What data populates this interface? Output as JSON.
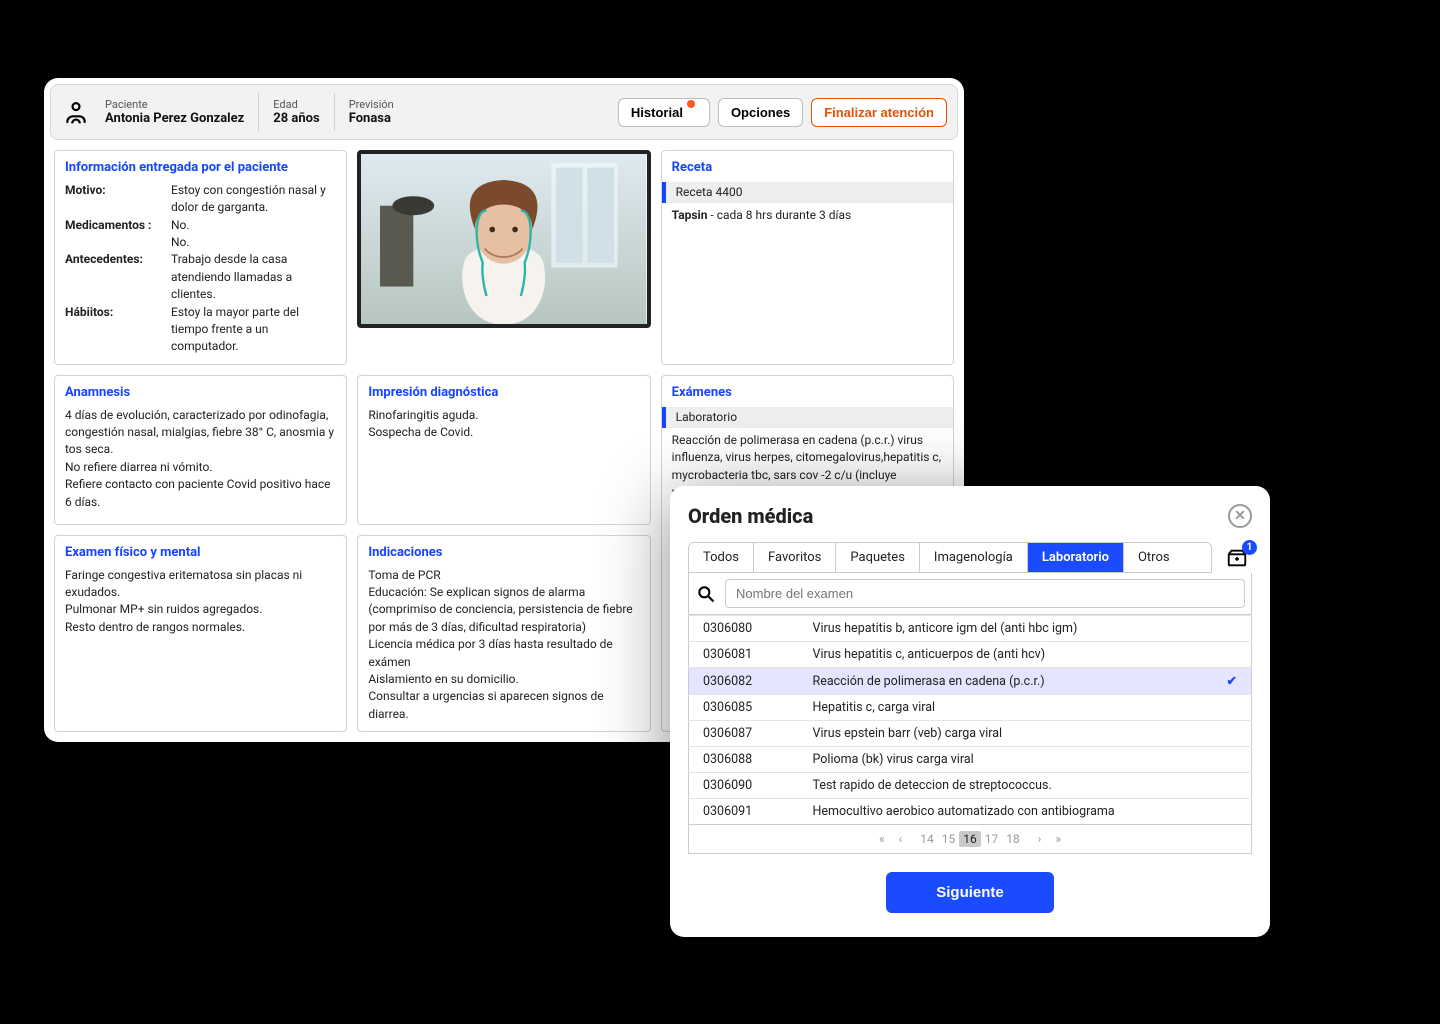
{
  "header": {
    "paciente_label": "Paciente",
    "paciente_value": "Antonia Perez Gonzalez",
    "edad_label": "Edad",
    "edad_value": "28 años",
    "prevision_label": "Previsión",
    "prevision_value": "Fonasa",
    "historial_btn": "Historial",
    "opciones_btn": "Opciones",
    "finalizar_btn": "Finalizar atención"
  },
  "info_card": {
    "title": "Información entregada por el paciente",
    "motivo_k": "Motivo:",
    "motivo_v": "Estoy con congestión nasal y dolor de garganta.",
    "medicamentos_k": "Medicamentos :",
    "medicamentos_v1": "No.",
    "medicamentos_v2": "No.",
    "antecedentes_k": "Antecedentes:",
    "antecedentes_v": "Trabajo desde la casa atendiendo llamadas a clientes.",
    "habitos_k": "Hábiitos:",
    "habitos_v": "Estoy la mayor parte del tiempo frente a un computador."
  },
  "receta_card": {
    "title": "Receta",
    "strip": "Receta 4400",
    "line": "Tapsin - cada 8 hrs durante 3 días"
  },
  "anam_card": {
    "title": "Anamnesis",
    "l1": "4 días de evolución, caracterizado por odinofagia, congestión nasal, mialgias, fiebre 38° C, anosmia y tos seca.",
    "l2": "No refiere diarrea ni vómito.",
    "l3": "Refiere contacto con paciente Covid positivo hace 6 días."
  },
  "diag_card": {
    "title": "Impresión diagnóstica",
    "l1": "Rinofaringitis aguda.",
    "l2": "Sospecha de Covid."
  },
  "indic_card": {
    "title": "Indicaciones",
    "l1": "Toma de PCR",
    "l2": "Educación: Se explican signos de alarma (comprimiso de conciencia, persistencia de fiebre por más de 3 días, dificultad respiratoria)",
    "l3": "Licencia médica por 3 días hasta resultado de exámen",
    "l4": "Aislamiento en su domicilio.",
    "l5": "Consultar a urgencias si aparecen signos de diarrea."
  },
  "exam_card": {
    "title": "Exámenes",
    "strip": "Laboratorio",
    "body": "Reacción de polimerasa en cadena (p.c.r.) virus influenza, virus herpes, citomegalovirus,hepatitis c, mycrobacteria tbc, sars cov -2 c/u (incluye muestra hisopado nasofaringeo)."
  },
  "fisico_card": {
    "title": "Examen físico y mental",
    "l1": "Faringe congestiva eritematosa sin placas ni exudados.",
    "l2": "Pulmonar MP+ sin ruidos agregados.",
    "l3": "Resto dentro de rangos normales."
  },
  "orden": {
    "title": "Orden médica",
    "tabs": {
      "todos": "Todos",
      "favoritos": "Favoritos",
      "paquetes": "Paquetes",
      "imagen": "Imagenología",
      "lab": "Laboratorio",
      "otros": "Otros"
    },
    "basket_count": "1",
    "search_placeholder": "Nombre del examen",
    "rows": [
      {
        "code": "0306080",
        "name": "Virus hepatitis b, anticore igm del (anti hbc igm)"
      },
      {
        "code": "0306081",
        "name": "Virus hepatitis c, anticuerpos de (anti hcv)"
      },
      {
        "code": "0306082",
        "name": "Reacción de polimerasa en cadena (p.c.r.)",
        "selected": true
      },
      {
        "code": "0306085",
        "name": "Hepatitis c, carga viral"
      },
      {
        "code": "0306087",
        "name": "Virus epstein barr (veb) carga viral"
      },
      {
        "code": "0306088",
        "name": "Polioma (bk) virus carga viral"
      },
      {
        "code": "0306090",
        "name": "Test rapido de deteccion de streptococcus."
      },
      {
        "code": "0306091",
        "name": "Hemocultivo aerobico automatizado con antibiograma"
      }
    ],
    "pager": {
      "pages": [
        "14",
        "15",
        "16",
        "17",
        "18"
      ],
      "current": "16"
    },
    "siguiente": "Siguiente"
  }
}
